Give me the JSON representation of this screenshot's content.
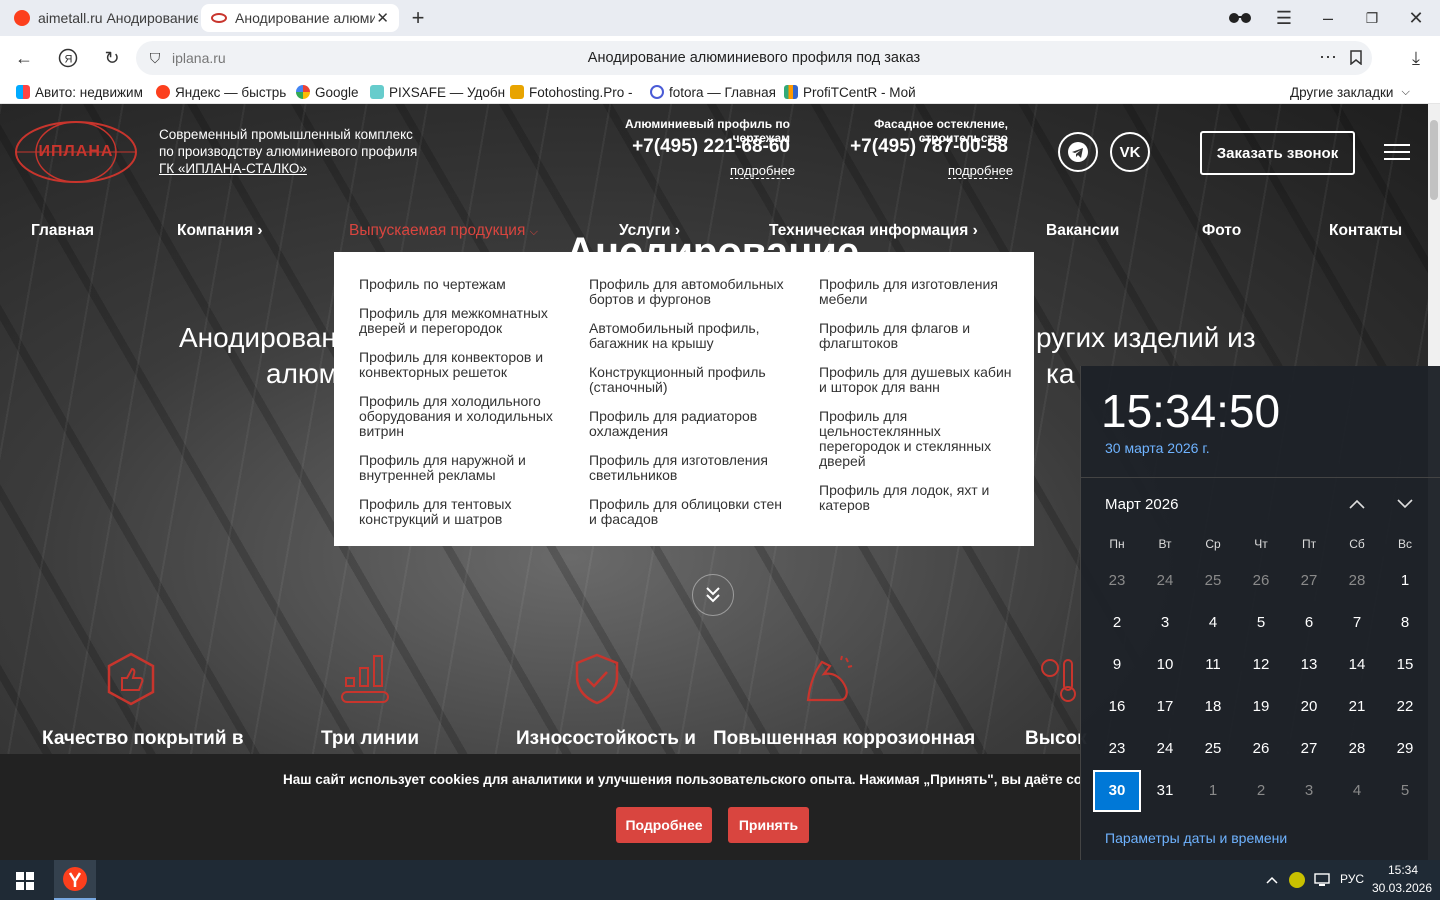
{
  "browser": {
    "tabs": [
      {
        "label": "aimetall.ru Анодирование"
      },
      {
        "label": "Анодирование алюмин"
      }
    ],
    "address": "iplana.ru",
    "page_title": "Анодирование алюминиевого профиля под заказ",
    "bookmarks": [
      "Авито: недвижим",
      "Яндекс — быстрь",
      "Google",
      "PIXSAFE — Удобн",
      "Fotohosting.Pro -",
      "fotora — Главная",
      "ProfiTCentR - Мой"
    ],
    "other_bookmarks": "Другие закладки"
  },
  "site": {
    "logo_text": "ИПЛАНА",
    "tagline": "Современный промышленный комплекс по производству алюминиевого профиля",
    "company_link": "ГК «ИПЛАНА-СТАЛКО»",
    "contacts": [
      {
        "caption": "Алюминиевый профиль по чертежам",
        "phone": "+7(495) 221-68-60",
        "more": "подробнее"
      },
      {
        "caption": "Фасадное остекление, строительство",
        "phone": "+7(495) 787-00-58",
        "more": "подробнее"
      }
    ],
    "callback_button": "Заказать звонок",
    "nav": [
      "Главная",
      "Компания",
      "Выпускаемая продукция",
      "Услуги",
      "Техническая информация",
      "Вакансии",
      "Фото",
      "Контакты"
    ],
    "hero_line1_left": "Анодировани",
    "hero_line1_right": "ругих изделий из",
    "hero_line2_left": "алюм",
    "hero_line2_right": "ка",
    "hero_partial_heading": "Анодирование",
    "dropdown": [
      [
        "Профиль по чертежам",
        "Профиль для межкомнатных дверей и перегородок",
        "Профиль для конвекторов и конвекторных решеток",
        "Профиль для холодильного оборудования и холодильных витрин",
        "Профиль для наружной и внутренней рекламы",
        "Профиль для тентовых конструкций и шатров"
      ],
      [
        "Профиль для автомобильных бортов и фургонов",
        "Автомобильный профиль, багажник на крышу",
        "Конструкционный профиль (станочный)",
        "Профиль для радиаторов охлаждения",
        "Профиль для изготовления светильников",
        "Профиль для облицовки стен и фасадов"
      ],
      [
        "Профиль для изготовления мебели",
        "Профиль для флагов и флагштоков",
        "Профиль для душевых кабин и шторок для ванн",
        "Профиль для цельностеклянных перегородок и стеклянных дверей",
        "Профиль для лодок, яхт и катеров"
      ]
    ],
    "features": [
      "Качество покрытий в",
      "Три линии",
      "Износостойкость и",
      "Повышенная коррозионная",
      "Высок"
    ],
    "cookie_text": "Наш сайт использует cookies для аналитики и улучшения пользовательского опыта. Нажимая „Принять\", вы даёте согласие на их испол",
    "cookie_more": "Подробнее",
    "cookie_accept": "Принять"
  },
  "clock": {
    "time": "15:34:50",
    "date": "30 марта 2026 г.",
    "month": "Март 2026",
    "weekdays": [
      "Пн",
      "Вт",
      "Ср",
      "Чт",
      "Пт",
      "Сб",
      "Вс"
    ],
    "days": [
      [
        "23",
        "24",
        "25",
        "26",
        "27",
        "28",
        "1"
      ],
      [
        "2",
        "3",
        "4",
        "5",
        "6",
        "7",
        "8"
      ],
      [
        "9",
        "10",
        "11",
        "12",
        "13",
        "14",
        "15"
      ],
      [
        "16",
        "17",
        "18",
        "19",
        "20",
        "21",
        "22"
      ],
      [
        "23",
        "24",
        "25",
        "26",
        "27",
        "28",
        "29"
      ],
      [
        "30",
        "31",
        "1",
        "2",
        "3",
        "4",
        "5"
      ]
    ],
    "settings_link": "Параметры даты и времени"
  },
  "taskbar": {
    "lang": "РУС",
    "time": "15:34",
    "date": "30.03.2026"
  },
  "colors": {
    "accent": "#d9453f",
    "clock_blue": "#0078d7",
    "link_blue": "#6fb3ff"
  }
}
